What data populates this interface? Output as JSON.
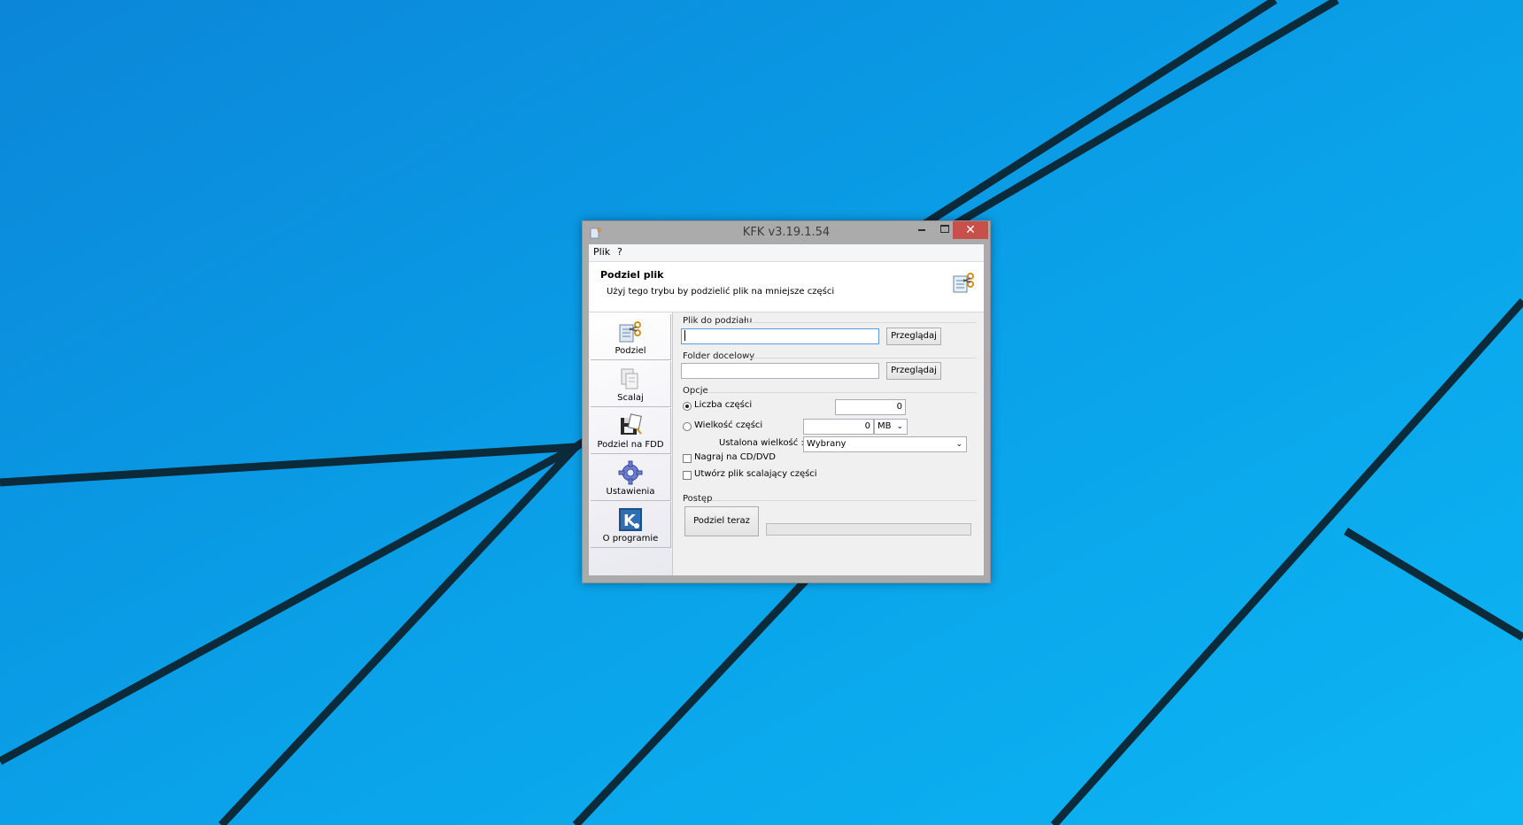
{
  "window": {
    "title": "KFK v3.19.1.54",
    "controls": {
      "minimize": "",
      "maximize": "",
      "close": "✕"
    }
  },
  "menu": [
    "Plik",
    "?"
  ],
  "header": {
    "title": "Podziel plik",
    "subtitle": "Użyj tego trybu by podzielić plik na mniejsze części"
  },
  "sidebar": {
    "items": [
      {
        "label": "Podziel",
        "icon": "split-file-icon"
      },
      {
        "label": "Scalaj",
        "icon": "merge-files-icon"
      },
      {
        "label": "Podziel na FDD",
        "icon": "floppy-disk-icon"
      },
      {
        "label": "Ustawienia",
        "icon": "settings-gear-icon"
      },
      {
        "label": "O programie",
        "icon": "about-k-icon"
      }
    ]
  },
  "split": {
    "source_label": "Plik do podziału",
    "source_value": "",
    "browse1": "Przeglądaj",
    "dest_label": "Folder docelowy",
    "dest_value": "",
    "browse2": "Przeglądaj"
  },
  "options": {
    "label": "Opcje",
    "parts_count_label": "Liczba części",
    "parts_count_value": "0",
    "parts_count_selected": true,
    "part_size_label": "Wielkość części",
    "part_size_value": "0",
    "part_size_unit": "MB",
    "fixed_size_label": "Ustalona wielkość :",
    "fixed_size_value": "Wybrany",
    "burn_cd_label": "Nagraj na CD/DVD",
    "create_merge_label": "Utwórz plik scalający części"
  },
  "progress": {
    "label": "Postęp",
    "split_now": "Podziel teraz",
    "value": 0
  },
  "colors": {
    "desktop": "#0aa2e8",
    "close_button": "#c7504b",
    "window_frame": "#ababab"
  }
}
